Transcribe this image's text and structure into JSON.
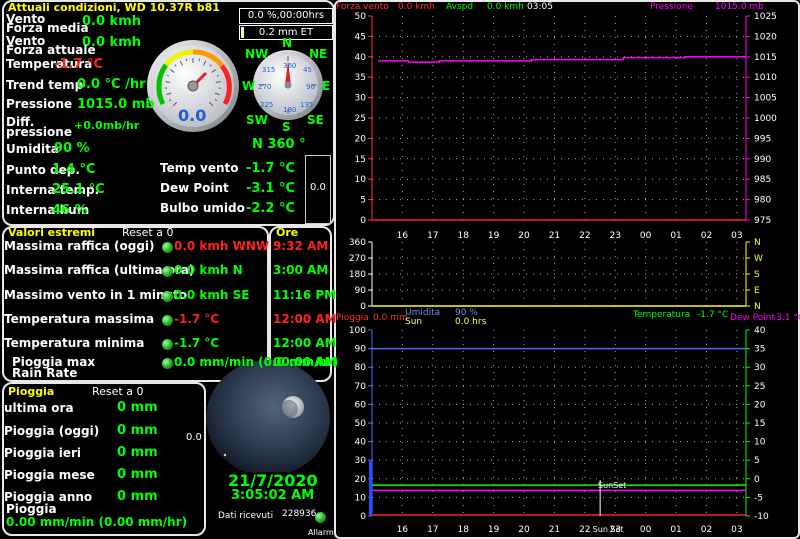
{
  "conditions": {
    "title": "Attuali condizioni, WD 10.37R b81",
    "rows": [
      {
        "label": "Vento",
        "value": "0.0 kmh"
      },
      {
        "label": "Forza media",
        "value": ""
      },
      {
        "label": "Vento",
        "value": "0.0 kmh"
      },
      {
        "label": "Forza attuale",
        "value": ""
      },
      {
        "label": "Temperatura",
        "value": "-1.7 °C"
      },
      {
        "label": "Trend temp",
        "value": "0.0 °C /hr"
      },
      {
        "label": "Pressione",
        "value": "1015.0 mb"
      },
      {
        "label": "Diff.",
        "value": ""
      },
      {
        "label": "pressione",
        "value": "+0.0mb/hr"
      },
      {
        "label": "Umidita",
        "value": "90 %"
      },
      {
        "label": "Punto dep.",
        "value": "1.4 °C"
      },
      {
        "label": "Interna temp.",
        "value": "25.1 °C"
      },
      {
        "label": "Interna hum",
        "value": "46 %"
      }
    ],
    "right_rows": [
      {
        "label": "Temp vento",
        "value": "-1.7 °C"
      },
      {
        "label": "Dew Point",
        "value": "-3.1 °C"
      },
      {
        "label": "Bulbo umido",
        "value": "-2.2 °C"
      }
    ],
    "gauge_value": "0.0",
    "wind_dir": "N  360 °",
    "rain_rate_box": "0.0 %,00:00hrs",
    "et_box": "0.2 mm ET",
    "side_box_value": "0.0",
    "compass": {
      "n": "N",
      "ne": "NE",
      "e": "E",
      "se": "SE",
      "s": "S",
      "sw": "SW",
      "w": "W",
      "nw": "NW",
      "degrees": [
        "360",
        "45",
        "90",
        "135",
        "180",
        "225",
        "270",
        "315"
      ]
    }
  },
  "extremes": {
    "title": "Valori estremi",
    "reset": "Reset a 0",
    "hours_title": "Ore",
    "rows": [
      {
        "label": "Massima raffica (oggi)",
        "value": "0.0 kmh WNW",
        "time": "9:32 AM",
        "red": true
      },
      {
        "label": "Massima raffica (ultima ora)",
        "value": "0.0 kmh  N",
        "time": "3:00 AM",
        "red": false
      },
      {
        "label": "Massimo vento in 1 minuto",
        "value": "0.0 kmh SE",
        "time": "11:16 PM",
        "red": false
      },
      {
        "label": "Temperatura massima",
        "value": "-1.7 °C",
        "time": "12:00 AM",
        "red": true
      },
      {
        "label": "Temperatura minima",
        "value": "-1.7 °C",
        "time": "12:00 AM",
        "red": false
      },
      {
        "label": "Pioggia max",
        "label2": "Rain Rate",
        "value": "0.0 mm/min (0.0 mm/hr)",
        "time": "00:00 AM",
        "red": false
      }
    ]
  },
  "rain": {
    "title": "Pioggia",
    "reset": "Reset a 0",
    "rows": [
      {
        "label": "ultima ora",
        "value": "0 mm"
      },
      {
        "label": "Pioggia (oggi)",
        "value": "0 mm"
      },
      {
        "label": "Pioggia ieri",
        "value": "0 mm"
      },
      {
        "label": "Pioggia mese",
        "value": "0 mm"
      },
      {
        "label": "Pioggia anno",
        "value": "0 mm"
      }
    ],
    "rate_label": "Pioggia",
    "rate_value": "0.00 mm/min (0.00 mm/hr)",
    "side_value": "0.0"
  },
  "clock": {
    "date": "21/7/2020",
    "time": "3:05:02 AM",
    "received_label": "Dati ricevuti",
    "received_value": "228936",
    "alarm_label": "Allarmi"
  },
  "colors": {
    "accent_green": "#00ff00",
    "red": "#ff2020",
    "title_yellow": "#ffff00",
    "pressure": "#ff00ff",
    "wind_axis": "#ffff00"
  },
  "charts": {
    "top_legend": {
      "wind": "Forza vento",
      "wind_val": "0.0 kmh",
      "avg": "Avspd",
      "avg_val": "0.0 kmh",
      "time": "03:05",
      "pressure": "Pressione",
      "pressure_val": "1015.0 mb"
    },
    "bottom_legend": {
      "rain": "Pioggia",
      "rain_val": "0.0 mm",
      "hum": "Umidita",
      "hum_val": "90 %",
      "sun": "Sun",
      "sun_val": "0.0 hrs",
      "temp": "Temperatura",
      "temp_val": "-1.7 °C",
      "dew": "Dew Point",
      "dew_val": "-3.1 °C"
    },
    "sunset_label": "SunSet",
    "sunrise_label": "Sun Set"
  },
  "chart_data": [
    {
      "type": "line",
      "x": [
        "16",
        "17",
        "18",
        "19",
        "20",
        "21",
        "22",
        "23",
        "00",
        "01",
        "02",
        "03"
      ],
      "left_ylim": [
        0,
        50
      ],
      "left_ticks": [
        "50",
        "45",
        "40",
        "35",
        "30",
        "25",
        "20",
        "15",
        "10",
        "5",
        "0"
      ],
      "right_ylim": [
        975,
        1025
      ],
      "right_ticks": [
        "1025",
        "1020",
        "1015",
        "1010",
        "1005",
        "1000",
        "995",
        "990",
        "985",
        "980",
        "975"
      ],
      "series": [
        {
          "name": "Forza vento",
          "axis": "left",
          "values": [
            0,
            0,
            0,
            0,
            0,
            0,
            0,
            0,
            0,
            0,
            0,
            0
          ]
        },
        {
          "name": "Pressione",
          "axis": "right",
          "values": [
            1014.0,
            1013.7,
            1014.0,
            1014.0,
            1014.0,
            1014.3,
            1014.3,
            1014.3,
            1014.8,
            1014.8,
            1015.0,
            1015.0
          ]
        }
      ]
    },
    {
      "type": "line",
      "x": [
        "16",
        "17",
        "18",
        "19",
        "20",
        "21",
        "22",
        "23",
        "00",
        "01",
        "02",
        "03"
      ],
      "left_ticks": [
        "360",
        "270",
        "180",
        "90",
        "0"
      ],
      "right_ticks": [
        "N",
        "W",
        "S",
        "E",
        "N"
      ],
      "series": [
        {
          "name": "",
          "values": [
            0,
            0,
            0,
            0,
            0,
            0,
            0,
            0,
            0,
            0,
            0,
            0
          ]
        }
      ]
    },
    {
      "type": "line",
      "x": [
        "16",
        "17",
        "18",
        "19",
        "20",
        "21",
        "22",
        "23",
        "00",
        "01",
        "02",
        "03"
      ],
      "left_ylim": [
        0,
        100
      ],
      "left_ticks": [
        "100",
        "90",
        "80",
        "70",
        "60",
        "50",
        "40",
        "30",
        "20",
        "10",
        "0"
      ],
      "right_ylim": [
        -10,
        40
      ],
      "right_ticks": [
        "40",
        "35",
        "30",
        "25",
        "20",
        "15",
        "10",
        "5",
        "0",
        "-5",
        "-10"
      ],
      "series": [
        {
          "name": "Umidita",
          "axis": "left",
          "values": [
            90,
            90,
            90,
            90,
            90,
            90,
            90,
            90,
            90,
            90,
            90,
            90
          ]
        },
        {
          "name": "Temperatura",
          "axis": "right",
          "values": [
            -1.7,
            -1.7,
            -1.7,
            -1.7,
            -1.7,
            -1.7,
            -1.7,
            -1.7,
            -1.7,
            -1.7,
            -1.7,
            -1.7
          ]
        },
        {
          "name": "Dew Point",
          "axis": "right",
          "values": [
            -3.1,
            -3.1,
            -3.1,
            -3.1,
            -3.1,
            -3.1,
            -3.1,
            -3.1,
            -3.1,
            -3.1,
            -3.1,
            -3.1
          ]
        },
        {
          "name": "Pioggia",
          "axis": "left",
          "values": [
            0,
            0,
            0,
            0,
            0,
            0,
            0,
            0,
            0,
            0,
            0,
            0
          ]
        }
      ]
    }
  ]
}
